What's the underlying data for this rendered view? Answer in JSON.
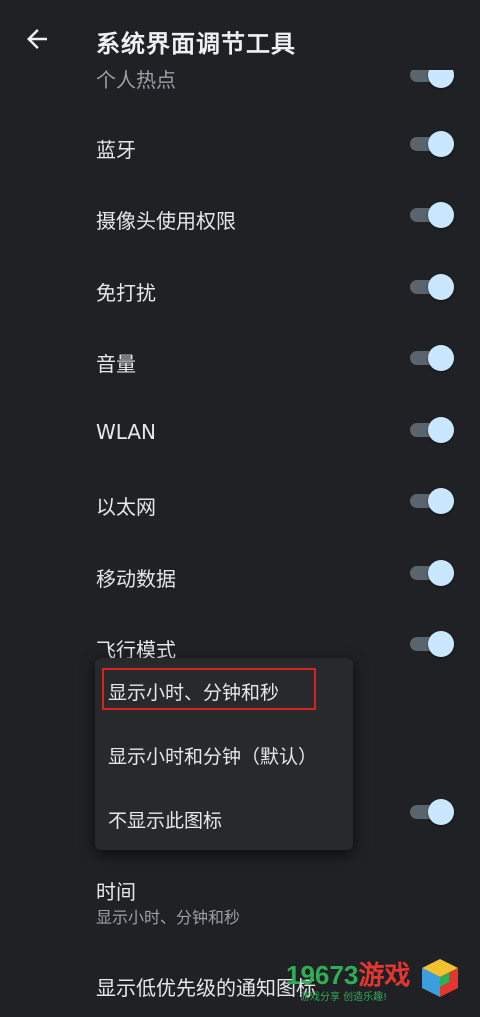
{
  "header": {
    "title": "系统界面调节工具",
    "back_icon": "arrow-left-icon"
  },
  "settings": {
    "partial_item": "个人热点",
    "items": [
      {
        "label": "蓝牙",
        "enabled": true
      },
      {
        "label": "摄像头使用权限",
        "enabled": true
      },
      {
        "label": "免打扰",
        "enabled": true
      },
      {
        "label": "音量",
        "enabled": true
      },
      {
        "label": "WLAN",
        "enabled": true
      },
      {
        "label": "以太网",
        "enabled": true
      },
      {
        "label": "移动数据",
        "enabled": true
      },
      {
        "label": "飞行模式",
        "enabled": true
      }
    ]
  },
  "menu": {
    "options": [
      "显示小时、分钟和秒",
      "显示小时和分钟（默认）",
      "不显示此图标"
    ]
  },
  "time_setting": {
    "title": "时间",
    "summary": "显示小时、分钟和秒"
  },
  "low_priority_item": "显示低优先级的通知图标",
  "watermark": {
    "brand_num": "19673",
    "brand_cn": "游戏",
    "slogan": "游戏分享  创造乐趣!"
  },
  "colors": {
    "background": "#1f2125",
    "toggle_thumb": "#c9e7ff",
    "toggle_track": "#5a646c",
    "highlight": "#d6231f"
  }
}
